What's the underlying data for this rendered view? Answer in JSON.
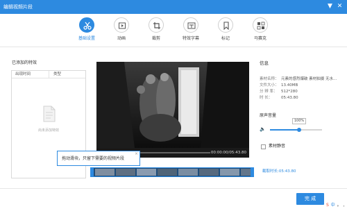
{
  "window": {
    "title": "编辑视频片段",
    "controls": [
      "▼",
      "✕"
    ]
  },
  "toolbar": {
    "items": [
      {
        "label": "基础设置",
        "icon": "scissors-icon",
        "active": true
      },
      {
        "label": "动画",
        "icon": "animation-icon",
        "active": false
      },
      {
        "label": "裁剪",
        "icon": "crop-icon",
        "active": false
      },
      {
        "label": "特效字幕",
        "icon": "subtitle-effects-icon",
        "active": false
      },
      {
        "label": "标记",
        "icon": "bookmark-icon",
        "active": false
      },
      {
        "label": "马赛克",
        "icon": "mosaic-icon",
        "active": false
      }
    ]
  },
  "effects_panel": {
    "title": "已添加的特效",
    "columns": [
      "出现时间",
      "类型"
    ],
    "empty_text": "尚未添加特效"
  },
  "player": {
    "time": "00:00:00/05:43.80",
    "progress": 0
  },
  "tooltip": {
    "text": "拖动滑块，只留下需要的视频片段",
    "close": "×"
  },
  "clip": {
    "length_text": "截取时长:05:43.80"
  },
  "info": {
    "title": "信息",
    "rows": [
      {
        "key": "素材名称：",
        "value": "元素的感烈爆破 素材拍摄 无水…"
      },
      {
        "key": "文件大小：",
        "value": "13.40MB"
      },
      {
        "key": "分 辨 率：",
        "value": "512*280"
      },
      {
        "key": "时    长：",
        "value": "05:43.80"
      }
    ]
  },
  "volume": {
    "label": "原声音量",
    "value_text": "100%",
    "level": 0.56
  },
  "mute": {
    "label": "素材静音",
    "checked": false
  },
  "actions": {
    "done_label": "完 成"
  },
  "tray": {
    "items": [
      {
        "text": "S",
        "color": "#e8482e"
      },
      {
        "text": "中",
        "color": "#2d8ae0"
      },
      {
        "text": "。",
        "color": "#333333"
      },
      {
        "text": ",",
        "color": "#333333"
      }
    ]
  }
}
